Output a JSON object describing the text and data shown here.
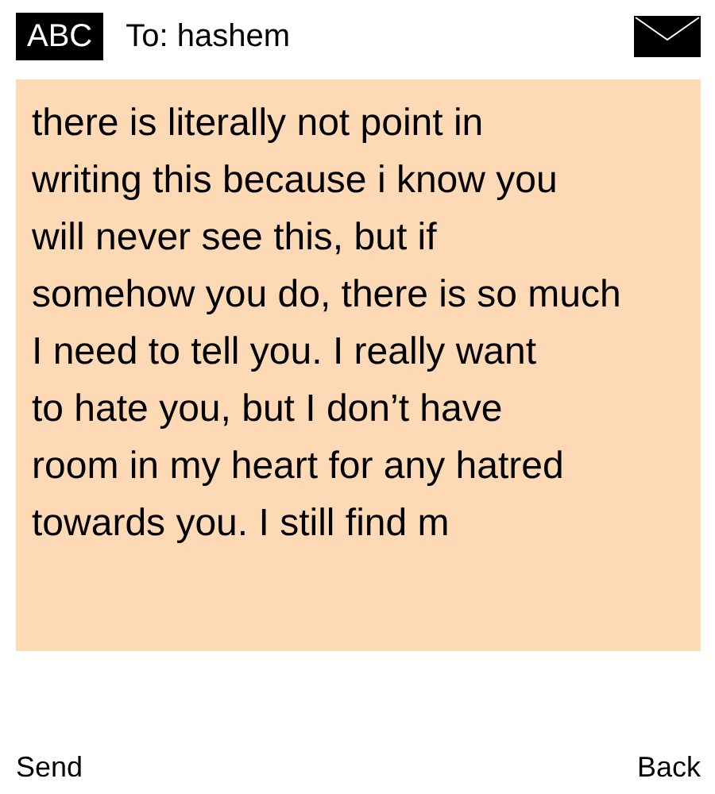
{
  "header": {
    "input_mode": "ABC",
    "recipient": "To: hashem"
  },
  "message": {
    "text": "there is literally not point in\nwriting this because i know you\nwill never see this, but if\nsomehow you do, there is so much\nI need to tell you. I really want\nto hate you, but I don’t have\nroom in my heart for any hatred\ntowards you. I still find m"
  },
  "softkeys": {
    "left": "Send",
    "right": "Back"
  }
}
